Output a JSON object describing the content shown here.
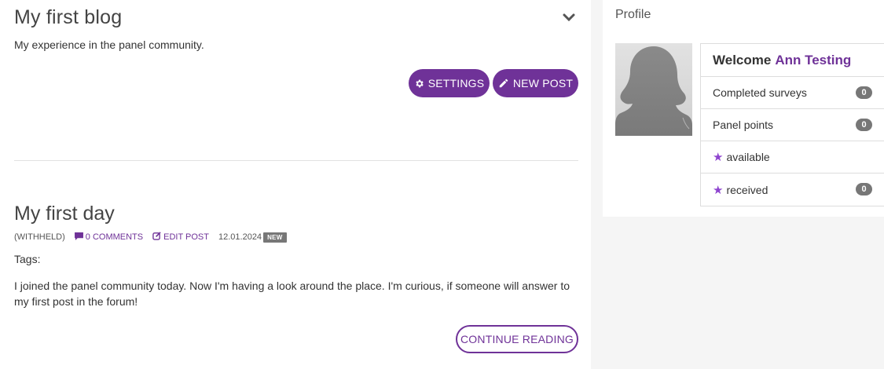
{
  "blog": {
    "title": "My first blog",
    "description": "My experience in the panel community.",
    "settings_label": "SETTINGS",
    "new_post_label": "NEW POST"
  },
  "post": {
    "title": "My first day",
    "author": "(WITHHELD)",
    "comments_label": "0 COMMENTS",
    "edit_label": "EDIT POST",
    "date": "12.01.2024",
    "badge": "NEW",
    "tags_label": "Tags:",
    "body": "I joined the panel community today. Now I'm having a look around the place. I'm curious, if someone will answer to my first post in the forum!",
    "continue_label": "CONTINUE READING"
  },
  "profile": {
    "heading": "Profile",
    "welcome": "Welcome",
    "user_name": "Ann Testing",
    "stats": [
      {
        "label": "Completed surveys",
        "count": "0"
      },
      {
        "label": "Panel points",
        "count": "0"
      },
      {
        "label": "available"
      },
      {
        "label": "received",
        "count": "0"
      }
    ]
  },
  "colors": {
    "accent": "#6f3298",
    "star": "#8e44cf",
    "badge": "#777777",
    "sidebar_bg": "#f5f5f5"
  },
  "icons": {
    "collapse": "chevron-down-icon",
    "settings": "gear-icon",
    "new_post": "pencil-icon",
    "comments": "comment-icon",
    "edit": "edit-icon",
    "points": "star-icon"
  }
}
